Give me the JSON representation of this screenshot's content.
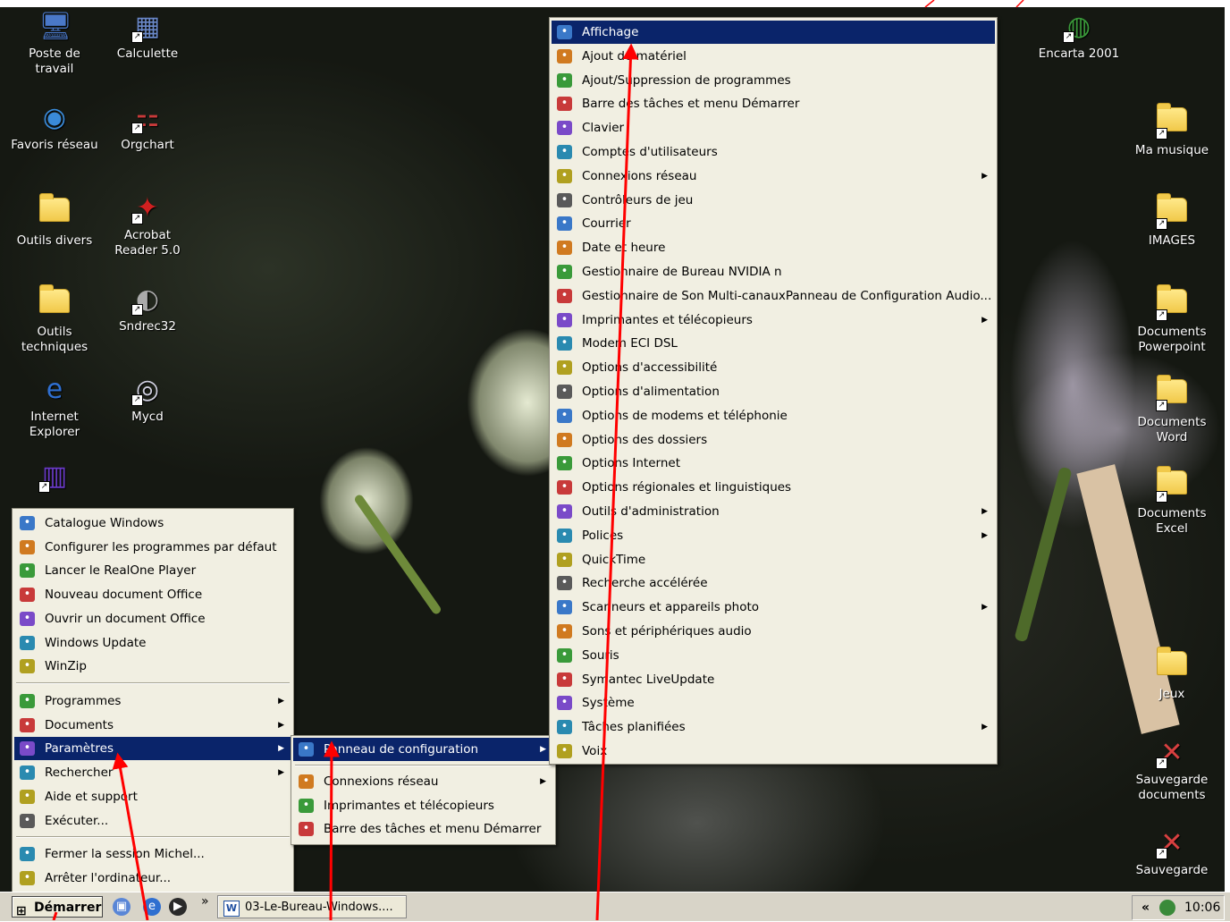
{
  "desktop": {
    "left_icons": [
      {
        "label": "Poste de travail",
        "icon": "computer-icon",
        "shortcut": false
      },
      {
        "label": "Calculette",
        "icon": "calculator-icon",
        "shortcut": true
      },
      {
        "label": "Favoris réseau",
        "icon": "network-icon",
        "shortcut": false
      },
      {
        "label": "Orgchart",
        "icon": "orgchart-icon",
        "shortcut": true
      },
      {
        "label": "Outils divers",
        "icon": "folder-icon",
        "shortcut": false
      },
      {
        "label": "Acrobat Reader 5.0",
        "icon": "acrobat-icon",
        "shortcut": true
      },
      {
        "label": "Outils techniques",
        "icon": "folder-icon",
        "shortcut": false
      },
      {
        "label": "Sndrec32",
        "icon": "speaker-icon",
        "shortcut": true
      },
      {
        "label": "Internet Explorer",
        "icon": "ie-icon",
        "shortcut": false
      },
      {
        "label": "Mycd",
        "icon": "cd-icon",
        "shortcut": true
      }
    ],
    "right_icons": [
      {
        "label": "Encarta 2001",
        "icon": "encarta-icon",
        "shortcut": true
      },
      {
        "label": "Ma musique",
        "icon": "folder-icon",
        "shortcut": true
      },
      {
        "label": "IMAGES",
        "icon": "folder-icon",
        "shortcut": true
      },
      {
        "label": "Documents Powerpoint",
        "icon": "folder-icon",
        "shortcut": true
      },
      {
        "label": "Documents Word",
        "icon": "folder-icon",
        "shortcut": true
      },
      {
        "label": "Documents Excel",
        "icon": "folder-icon",
        "shortcut": true
      },
      {
        "label": "Jeux",
        "icon": "folder-icon",
        "shortcut": false
      },
      {
        "label": "Sauvegarde documents",
        "icon": "backup-icon",
        "shortcut": true
      },
      {
        "label": "Sauvegarde",
        "icon": "backup-icon",
        "shortcut": true
      }
    ]
  },
  "start_menu": {
    "top_items": [
      {
        "label": "Catalogue Windows",
        "icon": "catalog-icon"
      },
      {
        "label": "Configurer les programmes par défaut",
        "icon": "defaults-icon"
      },
      {
        "label": "Lancer le RealOne Player",
        "icon": "realone-icon"
      },
      {
        "label": "Nouveau document Office",
        "icon": "new-doc-icon"
      },
      {
        "label": "Ouvrir un document Office",
        "icon": "open-folder-icon"
      },
      {
        "label": "Windows Update",
        "icon": "windows-update-icon"
      },
      {
        "label": "WinZip",
        "icon": "winzip-icon"
      }
    ],
    "main_items": [
      {
        "label": "Programmes",
        "icon": "programs-icon",
        "submenu": true
      },
      {
        "label": "Documents",
        "icon": "documents-icon",
        "submenu": true
      },
      {
        "label": "Paramètres",
        "icon": "settings-icon",
        "submenu": true,
        "highlighted": true
      },
      {
        "label": "Rechercher",
        "icon": "search-icon",
        "submenu": true
      },
      {
        "label": "Aide et support",
        "icon": "help-icon",
        "submenu": false
      },
      {
        "label": "Exécuter...",
        "icon": "run-icon",
        "submenu": false
      }
    ],
    "bottom_items": [
      {
        "label": "Fermer la session Michel...",
        "icon": "logoff-icon"
      },
      {
        "label": "Arrêter l'ordinateur...",
        "icon": "shutdown-icon"
      }
    ]
  },
  "settings_menu": {
    "items": [
      {
        "label": "Panneau de configuration",
        "icon": "control-panel-icon",
        "submenu": true,
        "highlighted": true
      },
      {
        "label": "Connexions réseau",
        "icon": "network-connections-icon",
        "submenu": true
      },
      {
        "label": "Imprimantes et télécopieurs",
        "icon": "printer-icon",
        "submenu": false
      },
      {
        "label": "Barre des tâches et menu Démarrer",
        "icon": "taskbar-icon",
        "submenu": false
      }
    ]
  },
  "control_panel_menu": {
    "items": [
      {
        "label": "Affichage",
        "icon": "display-icon",
        "submenu": false,
        "highlighted": true
      },
      {
        "label": "Ajout de matériel",
        "icon": "hardware-icon",
        "submenu": false
      },
      {
        "label": "Ajout/Suppression de programmes",
        "icon": "add-remove-icon",
        "submenu": false
      },
      {
        "label": "Barre des tâches et menu Démarrer",
        "icon": "taskbar-icon",
        "submenu": false
      },
      {
        "label": "Clavier",
        "icon": "keyboard-icon",
        "submenu": false
      },
      {
        "label": "Comptes d'utilisateurs",
        "icon": "users-icon",
        "submenu": false
      },
      {
        "label": "Connexions réseau",
        "icon": "network-connections-icon",
        "submenu": true
      },
      {
        "label": "Contrôleurs de jeu",
        "icon": "gamepad-icon",
        "submenu": false
      },
      {
        "label": "Courrier",
        "icon": "mail-icon",
        "submenu": false
      },
      {
        "label": "Date et heure",
        "icon": "clock-icon",
        "submenu": false
      },
      {
        "label": "Gestionnaire de Bureau NVIDIA n",
        "icon": "nvidia-icon",
        "submenu": false
      },
      {
        "label": "Gestionnaire de Son Multi-canauxPanneau de Configuration Audio...",
        "icon": "audio-manager-icon",
        "submenu": false
      },
      {
        "label": "Imprimantes et télécopieurs",
        "icon": "printer-icon",
        "submenu": true
      },
      {
        "label": "Modem ECI DSL",
        "icon": "modem-icon",
        "submenu": false
      },
      {
        "label": "Options d'accessibilité",
        "icon": "accessibility-icon",
        "submenu": false
      },
      {
        "label": "Options d'alimentation",
        "icon": "power-icon",
        "submenu": false
      },
      {
        "label": "Options de modems et téléphonie",
        "icon": "phone-icon",
        "submenu": false
      },
      {
        "label": "Options des dossiers",
        "icon": "folder-options-icon",
        "submenu": false
      },
      {
        "label": "Options Internet",
        "icon": "internet-options-icon",
        "submenu": false
      },
      {
        "label": "Options régionales et linguistiques",
        "icon": "globe-icon",
        "submenu": false
      },
      {
        "label": "Outils d'administration",
        "icon": "admin-tools-icon",
        "submenu": true
      },
      {
        "label": "Polices",
        "icon": "fonts-icon",
        "submenu": true
      },
      {
        "label": "QuickTime",
        "icon": "quicktime-icon",
        "submenu": false
      },
      {
        "label": "Recherche accélérée",
        "icon": "indexing-icon",
        "submenu": false
      },
      {
        "label": "Scanneurs et appareils photo",
        "icon": "scanner-icon",
        "submenu": true
      },
      {
        "label": "Sons et périphériques audio",
        "icon": "sound-icon",
        "submenu": false
      },
      {
        "label": "Souris",
        "icon": "mouse-icon",
        "submenu": false
      },
      {
        "label": "Symantec LiveUpdate",
        "icon": "liveupdate-icon",
        "submenu": false
      },
      {
        "label": "Système",
        "icon": "system-icon",
        "submenu": false
      },
      {
        "label": "Tâches planifiées",
        "icon": "scheduled-tasks-icon",
        "submenu": true
      },
      {
        "label": "Voix",
        "icon": "speech-icon",
        "submenu": false
      }
    ]
  },
  "taskbar": {
    "start_label": "Démarrer",
    "quick_launch": [
      "desktop-icon",
      "ie-icon",
      "media-player-icon"
    ],
    "chevron": "»",
    "task_item": "03-Le-Bureau-Windows....",
    "tray_chevron": "«",
    "clock": "10:06"
  },
  "colors": {
    "menu_bg": "#f1efe2",
    "highlight": "#0a246a",
    "annotation_arrow": "#ff0000"
  }
}
